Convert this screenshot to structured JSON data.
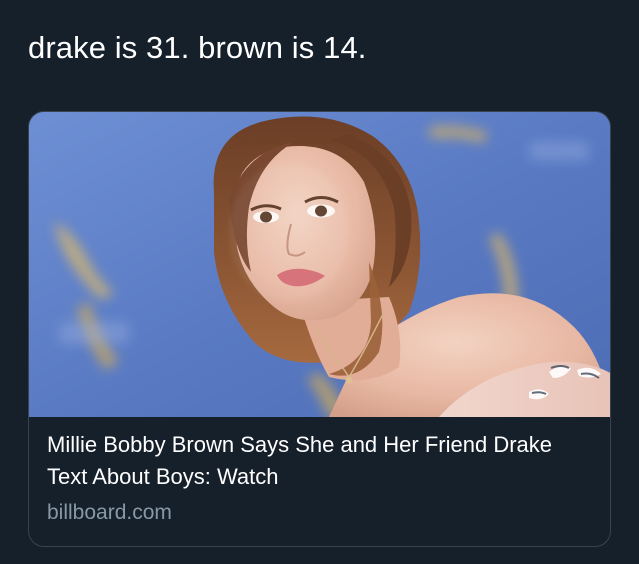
{
  "tweet": {
    "text": "drake is 31. brown is 14."
  },
  "link_card": {
    "image_alt": "Photo of a young woman with shoulder-length brown hair against a blue backdrop",
    "title": "Millie Bobby Brown Says She and Her Friend Drake Text About Boys: Watch",
    "domain": "billboard.com"
  },
  "colors": {
    "background": "#15202b",
    "text_primary": "#ffffff",
    "text_secondary": "#8899a6",
    "card_border": "#38444d"
  }
}
